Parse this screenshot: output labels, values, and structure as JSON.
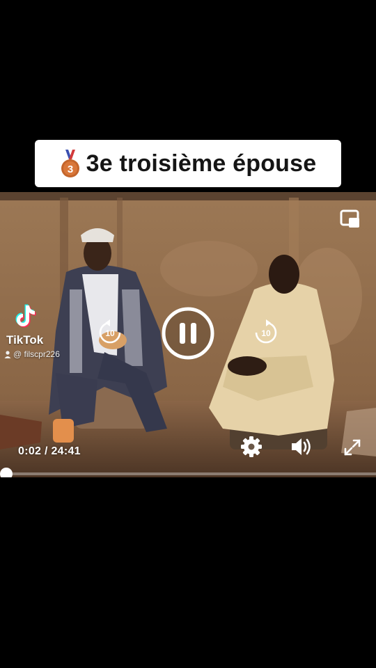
{
  "caption": {
    "medal_icon": "third-place-medal-icon",
    "medal_number": "3",
    "text": "3e troisième épouse"
  },
  "watermark": {
    "brand": "TikTok",
    "username": "@ filscpr226"
  },
  "player": {
    "current_time": "0:02 / 24:41",
    "rewind_seconds": "10",
    "forward_seconds": "10",
    "progress_fraction": 0.0014,
    "accent_color": "#ffffff"
  },
  "icons": {
    "pip": "picture-in-picture-icon",
    "pause": "pause-icon",
    "rewind": "rewind-10-icon",
    "forward": "forward-10-icon",
    "settings": "gear-icon",
    "volume": "volume-icon",
    "fullscreen": "fullscreen-icon"
  }
}
